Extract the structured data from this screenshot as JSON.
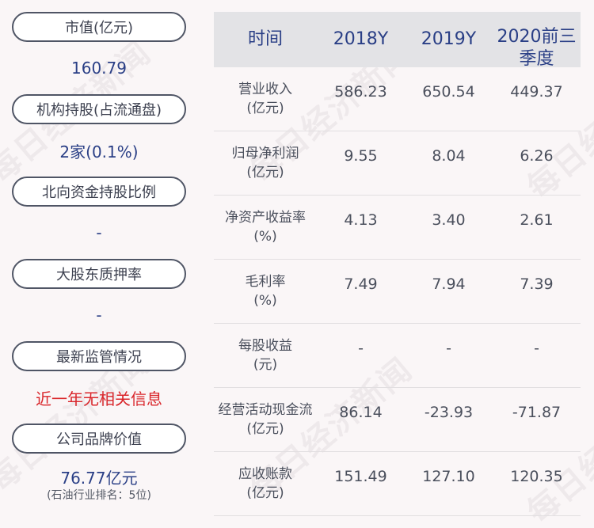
{
  "watermark": "每日经济新闻",
  "left": {
    "items": [
      {
        "label": "市值(亿元)",
        "value": "160.79",
        "color": "#2a3f86"
      },
      {
        "label": "机构持股(占流通盘)",
        "value": "2家(0.1%)",
        "color": "#2a3f86"
      },
      {
        "label": "北向资金持股比例",
        "value": "-",
        "color": "#2a3f86"
      },
      {
        "label": "大股东质押率",
        "value": "-",
        "color": "#2a3f86"
      },
      {
        "label": "最新监管情况",
        "value": "近一年无相关信息",
        "color": "#d9262b"
      }
    ],
    "brand": {
      "label": "公司品牌价值",
      "value": "76.77亿元",
      "sub": "(石油行业排名：5位)"
    }
  },
  "table": {
    "headers": [
      "时间",
      "2018Y",
      "2019Y",
      "2020前三季度"
    ],
    "rows": [
      {
        "label": "营业收入",
        "unit": "(亿元)",
        "values": [
          "586.23",
          "650.54",
          "449.37"
        ]
      },
      {
        "label": "归母净利润",
        "unit": "(亿元)",
        "values": [
          "9.55",
          "8.04",
          "6.26"
        ]
      },
      {
        "label": "净资产收益率",
        "unit": "(%)",
        "values": [
          "4.13",
          "3.40",
          "2.61"
        ]
      },
      {
        "label": "毛利率",
        "unit": "(%)",
        "values": [
          "7.49",
          "7.94",
          "7.39"
        ]
      },
      {
        "label": "每股收益",
        "unit": "(元)",
        "values": [
          "-",
          "-",
          "-"
        ]
      },
      {
        "label": "经营活动现金流",
        "unit": "(亿元)",
        "values": [
          "86.14",
          "-23.93",
          "-71.87"
        ]
      },
      {
        "label": "应收账款",
        "unit": "(亿元)",
        "values": [
          "151.49",
          "127.10",
          "120.35"
        ]
      }
    ]
  },
  "colors": {
    "accent": "#2a3f86",
    "alert": "#d9262b",
    "header_bg": "#e3e3e6",
    "background": "#faf6f7"
  }
}
